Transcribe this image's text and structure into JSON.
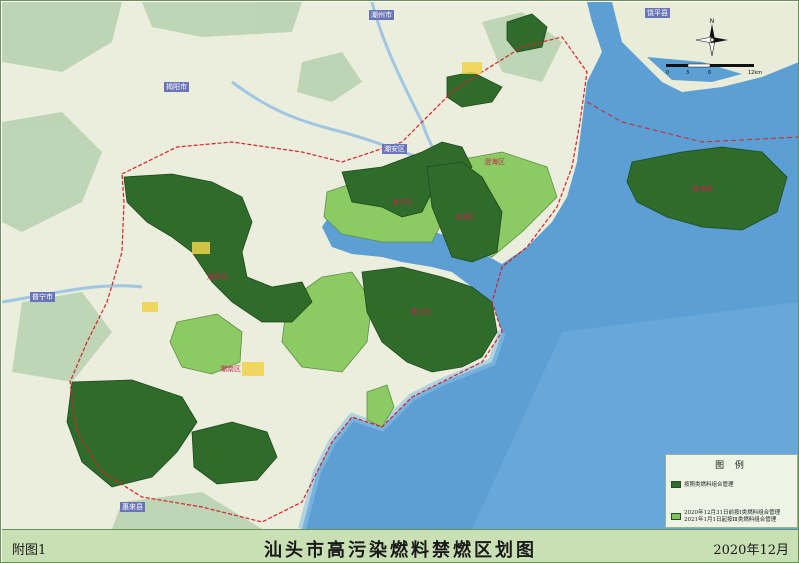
{
  "footer": {
    "left_label": "附图1",
    "title": "汕头市高污染燃料禁燃区划图",
    "date": "2020年12月"
  },
  "legend": {
    "title": "图  例",
    "items": [
      {
        "label": "按照类燃料组合管理",
        "color": "#2f6b2a"
      },
      {
        "label": "2020年12月31日前按Ⅰ类燃料组合管理\n2021年1月1日起按Ⅲ类燃料组合管理",
        "color": "#7fc15a"
      }
    ]
  },
  "compass": {
    "label": "N"
  },
  "scale": {
    "ticks": [
      "0",
      "3",
      "6",
      "12km"
    ]
  },
  "map_labels": {
    "cities": [
      {
        "text": "饶平县",
        "color": "#3b4a9a"
      },
      {
        "text": "潮州市",
        "color": "#3b4a9a"
      },
      {
        "text": "揭阳市",
        "color": "#3b4a9a"
      },
      {
        "text": "潮安区",
        "color": "#3b4a9a"
      },
      {
        "text": "普宁市",
        "color": "#3b4a9a"
      },
      {
        "text": "惠来县",
        "color": "#3b4a9a"
      }
    ],
    "districts": [
      {
        "text": "澄海区"
      },
      {
        "text": "龙湖区"
      },
      {
        "text": "金平区"
      },
      {
        "text": "濠江区"
      },
      {
        "text": "潮阳区"
      },
      {
        "text": "潮南区"
      },
      {
        "text": "南澳县"
      }
    ]
  },
  "colors": {
    "sea": "#5b9fd4",
    "dark_zone": "#2f6b2a",
    "light_zone": "#7fc15a",
    "land": "#f2f0d8",
    "hills": "#a8c7a0",
    "boundary": "#d8202a"
  }
}
